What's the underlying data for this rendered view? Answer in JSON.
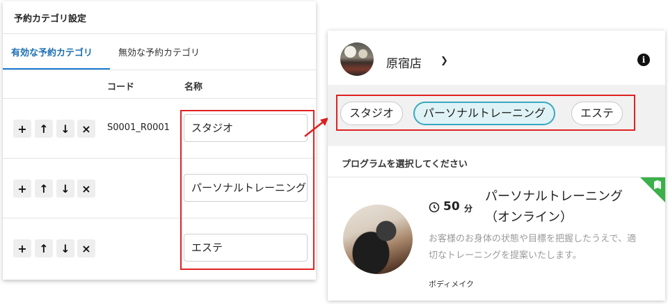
{
  "left": {
    "title": "予約カテゴリ設定",
    "tabs": [
      {
        "label": "有効な予約カテゴリ",
        "active": true
      },
      {
        "label": "無効な予約カテゴリ",
        "active": false
      }
    ],
    "columns": {
      "code": "コード",
      "name": "名称"
    },
    "rows": [
      {
        "code": "S0001_R0001",
        "name": "スタジオ"
      },
      {
        "code": "",
        "name": "パーソナルトレーニング"
      },
      {
        "code": "",
        "name": "エステ"
      }
    ],
    "controls": {
      "add": "+",
      "up": "↑",
      "down": "↓",
      "remove": "×"
    }
  },
  "right": {
    "store": {
      "name": "原宿店",
      "info_icon": "i"
    },
    "categories": [
      {
        "label": "スタジオ",
        "active": false
      },
      {
        "label": "パーソナルトレーニング",
        "active": true
      },
      {
        "label": "エステ",
        "active": false
      }
    ],
    "prompt": "プログラムを選択してください",
    "program": {
      "duration": "50",
      "duration_unit": "分",
      "title": "パーソナルトレーニング（オンライン）",
      "description": "お客様のお身体の状態や目標を把握したうえで、適切なトレーニングを提案いたします。",
      "tag": "ボディメイク"
    }
  },
  "colors": {
    "accent": "#1a7ad0",
    "highlight": "#e02020",
    "chip_active_border": "#37a8bf",
    "badge": "#3cb04a"
  }
}
